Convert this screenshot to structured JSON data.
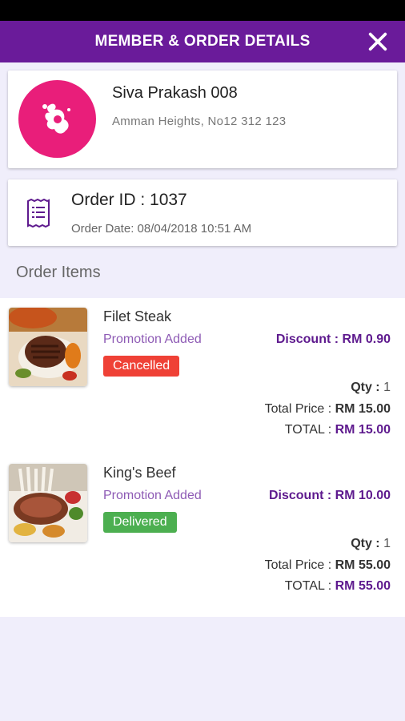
{
  "header": {
    "title": "MEMBER & ORDER DETAILS"
  },
  "member": {
    "name": "Siva Prakash 008",
    "address": "Amman Heights, No12 312 123"
  },
  "order": {
    "id_label": "Order ID : 1037",
    "date_label": "Order Date: 08/04/2018 10:51 AM"
  },
  "section": {
    "title": "Order Items"
  },
  "items": [
    {
      "name": "Filet Steak",
      "promo": "Promotion Added",
      "discount": "Discount : RM 0.90",
      "status": "Cancelled",
      "qty_label": "Qty :",
      "qty": "1",
      "total_price_label": "Total Price :",
      "total_price": "RM 15.00",
      "total_label": "TOTAL :",
      "total": "RM 15.00"
    },
    {
      "name": "King's Beef",
      "promo": "Promotion Added",
      "discount": "Discount : RM 10.00",
      "status": "Delivered",
      "qty_label": "Qty :",
      "qty": "1",
      "total_price_label": "Total Price :",
      "total_price": "RM 55.00",
      "total_label": "TOTAL :",
      "total": "RM 55.00"
    }
  ],
  "colors": {
    "header": "#6a1b9a",
    "avatar": "#e91e7a",
    "cancelled": "#ef4136",
    "delivered": "#4caf50",
    "accent_text": "#5e1a8e"
  },
  "icons": {
    "close": "close-icon",
    "receipt": "receipt-icon",
    "avatar": "avatar-logo-icon"
  }
}
